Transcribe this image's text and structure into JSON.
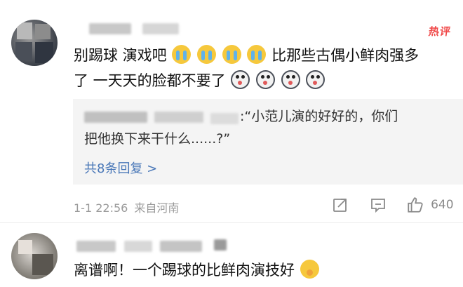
{
  "badge": {
    "hot_label": "热评"
  },
  "comment1": {
    "text_line1a": "别踢球 演戏吧",
    "text_line1b": "比那些古偶小鲜肉强多",
    "text_line2": "了 一天天的脸都不要了",
    "reply": {
      "quote_line1": ":“小范儿演的好好的，你们",
      "quote_line2": "把他换下来干什么......?”",
      "view_replies": "共8条回复 >"
    },
    "meta": {
      "time": "1-1 22:56",
      "location": "来自河南",
      "like_count": "640"
    }
  },
  "comment2": {
    "text": "离谱啊！一个踢球的比鲜肉演技好"
  },
  "icons": {
    "share": "share-icon",
    "comment": "comment-icon",
    "like": "thumbs-up-icon"
  }
}
